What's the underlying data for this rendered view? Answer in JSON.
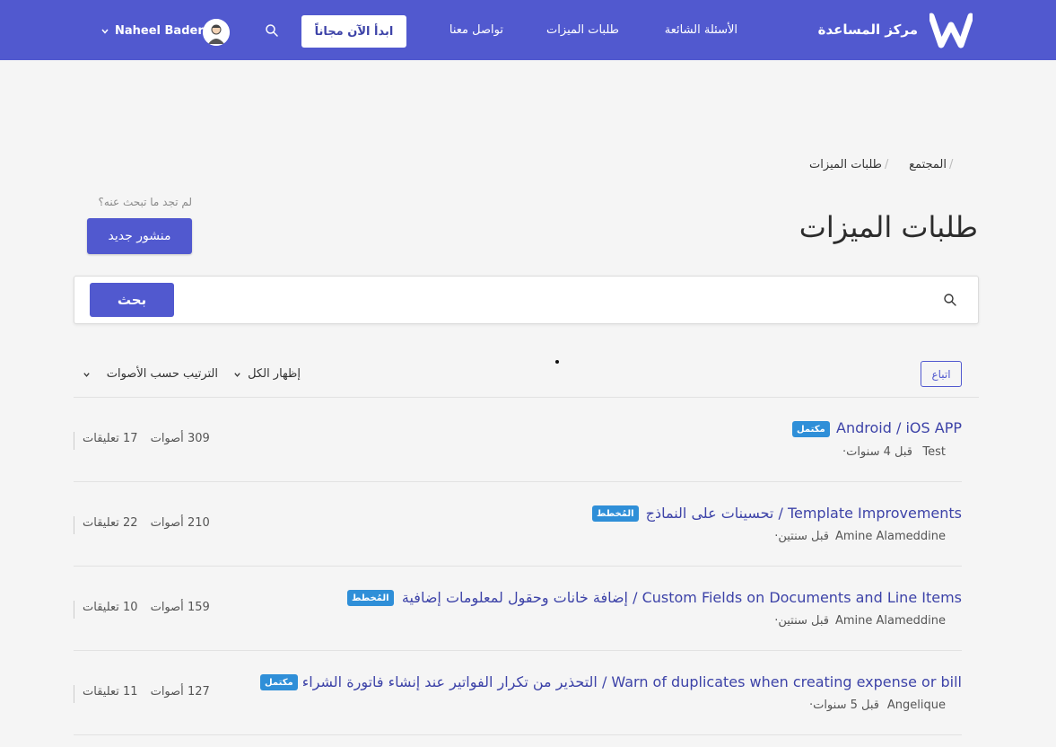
{
  "header": {
    "brand": "مركز المساعدة",
    "nav": [
      "الأسئلة الشائعة",
      "طلبات الميزات",
      "تواصل معنا"
    ],
    "cta": "ابدأ الآن مجاناً",
    "user_name": "Naheel Bader",
    "accent": "#5159cf"
  },
  "breadcrumb": [
    "المجتمع",
    "طلبات الميزات"
  ],
  "page": {
    "title": "طلبات الميزات",
    "hint": "لم تجد ما تبحث عنه؟",
    "new_post": "منشور جديد"
  },
  "search": {
    "button": "بحث",
    "placeholder": ""
  },
  "filters": {
    "follow": "اتباع",
    "show": "إظهار الكل",
    "sort": "الترتيب حسب الأصوات"
  },
  "posts": [
    {
      "title": "Android / iOS APP",
      "badge": "مكتمل",
      "badge_color": "#2f8fd8",
      "author": "Test",
      "time": "قبل 4 سنوات",
      "votes": "309 أصوات",
      "comments": "17 تعليقات"
    },
    {
      "title": "Template Improvements / تحسينات على النماذج",
      "badge": "المُخطط",
      "badge_color": "#2f8fd8",
      "author": "Amine Alameddine",
      "time": "قبل سنتين",
      "votes": "210 أصوات",
      "comments": "22 تعليقات"
    },
    {
      "title": "Custom Fields on Documents and Line Items / إضافة خانات وحقول لمعلومات إضافية",
      "badge": "المُخطط",
      "badge_color": "#2f8fd8",
      "author": "Amine Alameddine",
      "time": "قبل سنتين",
      "votes": "159 أصوات",
      "comments": "10 تعليقات"
    },
    {
      "title": "Warn of duplicates when creating expense or bill / التحذير من تكرار الفواتير عند إنشاء فاتورة الشراء",
      "badge": "مكتمل",
      "badge_color": "#2f8fd8",
      "author": "Angelique",
      "time": "قبل 5 سنوات",
      "votes": "127 أصوات",
      "comments": "11 تعليقات"
    }
  ]
}
